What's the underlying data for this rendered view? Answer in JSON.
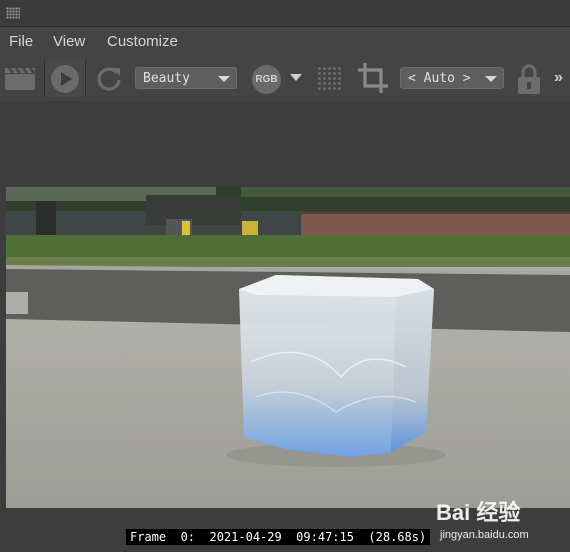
{
  "menu": {
    "items": [
      "File",
      "View",
      "Customize"
    ]
  },
  "toolbar": {
    "render_pass": "Beauty",
    "channel_badge": "RGB",
    "zoom_mode": "< Auto >",
    "overflow": "»",
    "icons": [
      "clapperboard-icon",
      "play-icon",
      "refresh-icon",
      "crop-icon",
      "lock-icon"
    ]
  },
  "status": {
    "text": "Frame  0:  2021-04-29  09:47:15  (28.68s)"
  },
  "watermark": {
    "logo": "Bai  经验",
    "site": "jingyan.baidu.com"
  },
  "colors": {
    "chrome": "#444444",
    "titlebar": "#3b3b3b",
    "viewport": "#3d3d3d",
    "control": "#5e5e5e"
  }
}
